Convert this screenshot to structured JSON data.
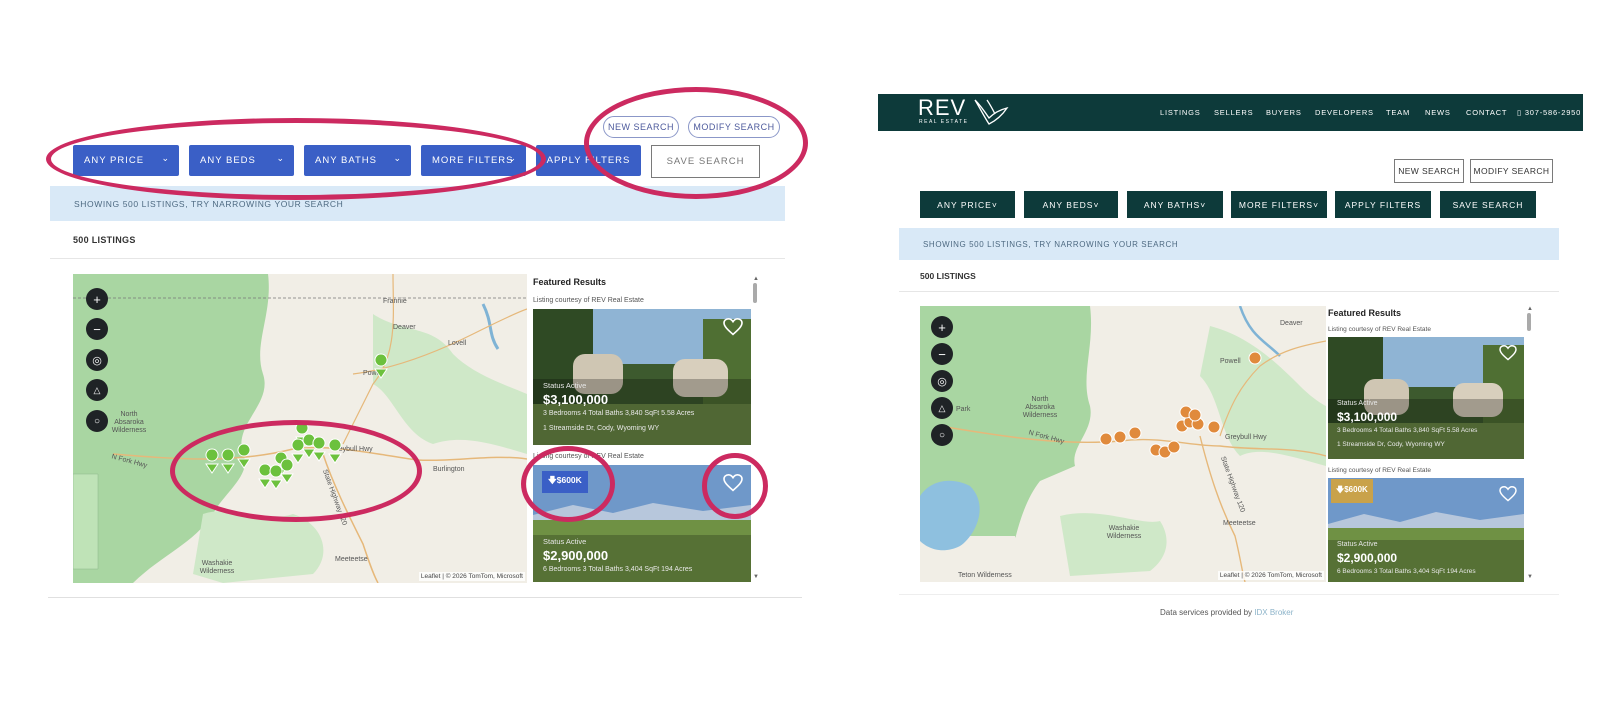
{
  "left": {
    "top_buttons": {
      "new_search": "NEW SEARCH",
      "modify_search": "MODIFY SEARCH"
    },
    "filters": [
      "ANY PRICE",
      "ANY BEDS",
      "ANY BATHS",
      "MORE FILTERS"
    ],
    "apply_filters": "APPLY FILTERS",
    "save_search": "SAVE SEARCH",
    "banner": "SHOWING 500 LISTINGS, TRY NARROWING YOUR SEARCH",
    "count": "500 LISTINGS",
    "featured_title": "Featured Results",
    "courtesy": "Listing courtesy of REV Real Estate",
    "listing1": {
      "status": "Status Active",
      "price": "$3,100,000",
      "meta": "3 Bedrooms   4 Total Baths   3,840 SqFt   5.58 Acres",
      "address": "1 Streamside Dr, Cody, Wyoming WY"
    },
    "listing2": {
      "status": "Status Active",
      "price": "$2,900,000",
      "meta": "6 Bedrooms   3 Total Baths   3,404 SqFt   194 Acres",
      "badge": "$600K"
    },
    "map": {
      "labels": [
        "Frannie",
        "Deaver",
        "Lovell",
        "Powell",
        "North Absaroka Wilderness",
        "N Fork Hwy",
        "Burlington",
        "Washakie Wilderness",
        "Meeteetse",
        "State Highway 120",
        "Greybull Hwy"
      ],
      "attribution": "Leaflet | © 2026 TomTom, Microsoft",
      "controls": [
        "+",
        "−"
      ]
    },
    "pin_color": "#6cc13d",
    "button_color": "#3a5fc6"
  },
  "right": {
    "brand": "REV",
    "brand_sub": "REAL ESTATE",
    "nav": [
      "LISTINGS",
      "SELLERS",
      "BUYERS",
      "DEVELOPERS",
      "TEAM",
      "NEWS",
      "CONTACT"
    ],
    "phone": "307-586-2950",
    "top_buttons": {
      "new_search": "NEW SEARCH",
      "modify_search": "MODIFY SEARCH"
    },
    "filters": [
      "ANY PRICE",
      "ANY BEDS",
      "ANY BATHS",
      "MORE FILTERS"
    ],
    "apply_filters": "APPLY FILTERS",
    "save_search": "SAVE SEARCH",
    "banner": "SHOWING 500 LISTINGS, TRY NARROWING YOUR SEARCH",
    "count": "500 LISTINGS",
    "featured_title": "Featured Results",
    "courtesy": "Listing courtesy of REV Real Estate",
    "listing1": {
      "status": "Status Active",
      "price": "$3,100,000",
      "meta": "3 Bedrooms   4 Total Baths   3,840 SqFt   5.58 Acres",
      "address": "1 Streamside Dr, Cody, Wyoming WY"
    },
    "listing2": {
      "status": "Status Active",
      "price": "$2,900,000",
      "meta": "6 Bedrooms   3 Total Baths   3,404 SqFt   194 Acres",
      "badge": "$600K"
    },
    "map": {
      "labels": [
        "Deaver",
        "Powell",
        "North Absaroka Wilderness",
        "N Fork Hwy",
        "Washakie Wilderness",
        "Meeteetse",
        "Teton Wilderness",
        "Park",
        "State Highway 120",
        "Greybull Hwy"
      ],
      "attribution": "Leaflet | © 2026 TomTom, Microsoft",
      "controls": [
        "+",
        "−"
      ]
    },
    "footer_text": "Data services provided by",
    "footer_link": "IDX Broker",
    "pin_color": "#e08a3c",
    "header_color": "#0d3a3a",
    "badge_color": "#c9a24a"
  }
}
